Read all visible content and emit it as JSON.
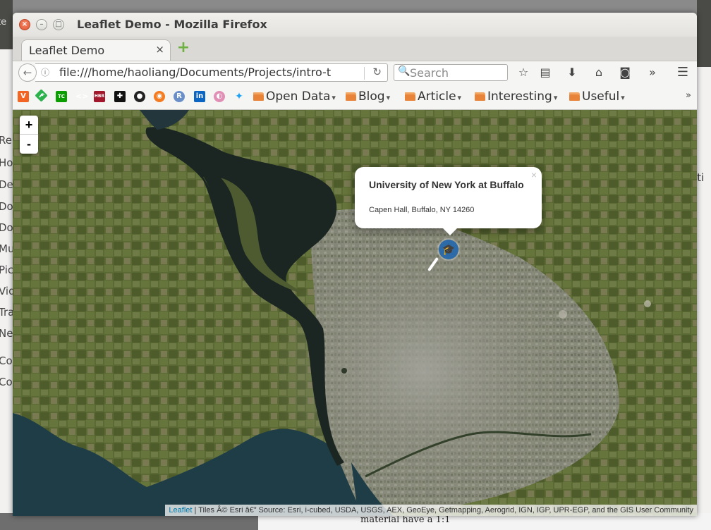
{
  "window": {
    "title": "Leaflet Demo - Mozilla Firefox",
    "close_glyph": "×",
    "min_glyph": "–",
    "max_glyph": "□"
  },
  "tab": {
    "title": "Leaflet Demo",
    "close_glyph": "×",
    "new_tab_glyph": "+"
  },
  "navbar": {
    "back_glyph": "←",
    "info_glyph": "ⓘ",
    "url": "file:///home/haoliang/Documents/Projects/intro-t",
    "reload_glyph": "↻",
    "search_placeholder": "Search",
    "search_glyph": "🔍",
    "icons": [
      {
        "name": "bookmark-star-icon",
        "glyph": "☆"
      },
      {
        "name": "reading-list-icon",
        "glyph": "▤"
      },
      {
        "name": "downloads-icon",
        "glyph": "⬇"
      },
      {
        "name": "home-icon",
        "glyph": "⌂"
      },
      {
        "name": "pocket-icon",
        "glyph": "◙"
      },
      {
        "name": "overflow-icon",
        "glyph": "»"
      },
      {
        "name": "menu-icon",
        "glyph": "☰"
      }
    ]
  },
  "bookmarks": {
    "icons": [
      {
        "name": "vox-icon",
        "glyph": "V",
        "color": "#f26522"
      },
      {
        "name": "feedly-icon",
        "glyph": "f",
        "color": "#2bb24c"
      },
      {
        "name": "techcrunch-icon",
        "glyph": "TC",
        "color": "#0a9e01"
      },
      {
        "name": "code-icon",
        "glyph": "<>",
        "color": "#e8422f"
      },
      {
        "name": "hbr-icon",
        "glyph": "HBR",
        "color": "#a3172c"
      },
      {
        "name": "cross-icon",
        "glyph": "✚",
        "color": "#111111"
      },
      {
        "name": "github-icon",
        "glyph": "●",
        "color": "#222222"
      },
      {
        "name": "orange-circle-icon",
        "glyph": "◉",
        "color": "#f47b20"
      },
      {
        "name": "r-icon",
        "glyph": "R",
        "color": "#6a8fc8"
      },
      {
        "name": "linkedin-icon",
        "glyph": "in",
        "color": "#0a66c2"
      },
      {
        "name": "gradient-icon",
        "glyph": "◐",
        "color": "#e28fb5"
      },
      {
        "name": "twitter-icon",
        "glyph": "✦",
        "color": "#1da1f2"
      }
    ],
    "folders": [
      "Open Data",
      "Blog",
      "Article",
      "Interesting",
      "Useful"
    ],
    "more_glyph": "»"
  },
  "map": {
    "zoom_in_label": "+",
    "zoom_out_label": "-",
    "popup": {
      "title": "University of New York at Buffalo",
      "address": "Capen Hall, Buffalo, NY 14260",
      "close_glyph": "×"
    },
    "marker_glyph": "🎓",
    "attribution": {
      "link": "Leaflet",
      "text": " | Tiles Â© Esri â€” Source: Esri, i-cubed, USDA, USGS, AEX, GeoEye, Getmapping, Aerogrid, IGN, IGP, UPR-EGP, and the GIS User Community"
    }
  },
  "background": {
    "left_fragments": [
      "Re",
      "Ho",
      "De",
      "Do",
      "Do",
      "Mu",
      "Pic",
      "Vid",
      "Tra",
      "Ne",
      "Co",
      "Co"
    ],
    "top_left_fragment": "te",
    "right_fragment": "iti",
    "bottom_fragment": "material have a 1:1"
  }
}
